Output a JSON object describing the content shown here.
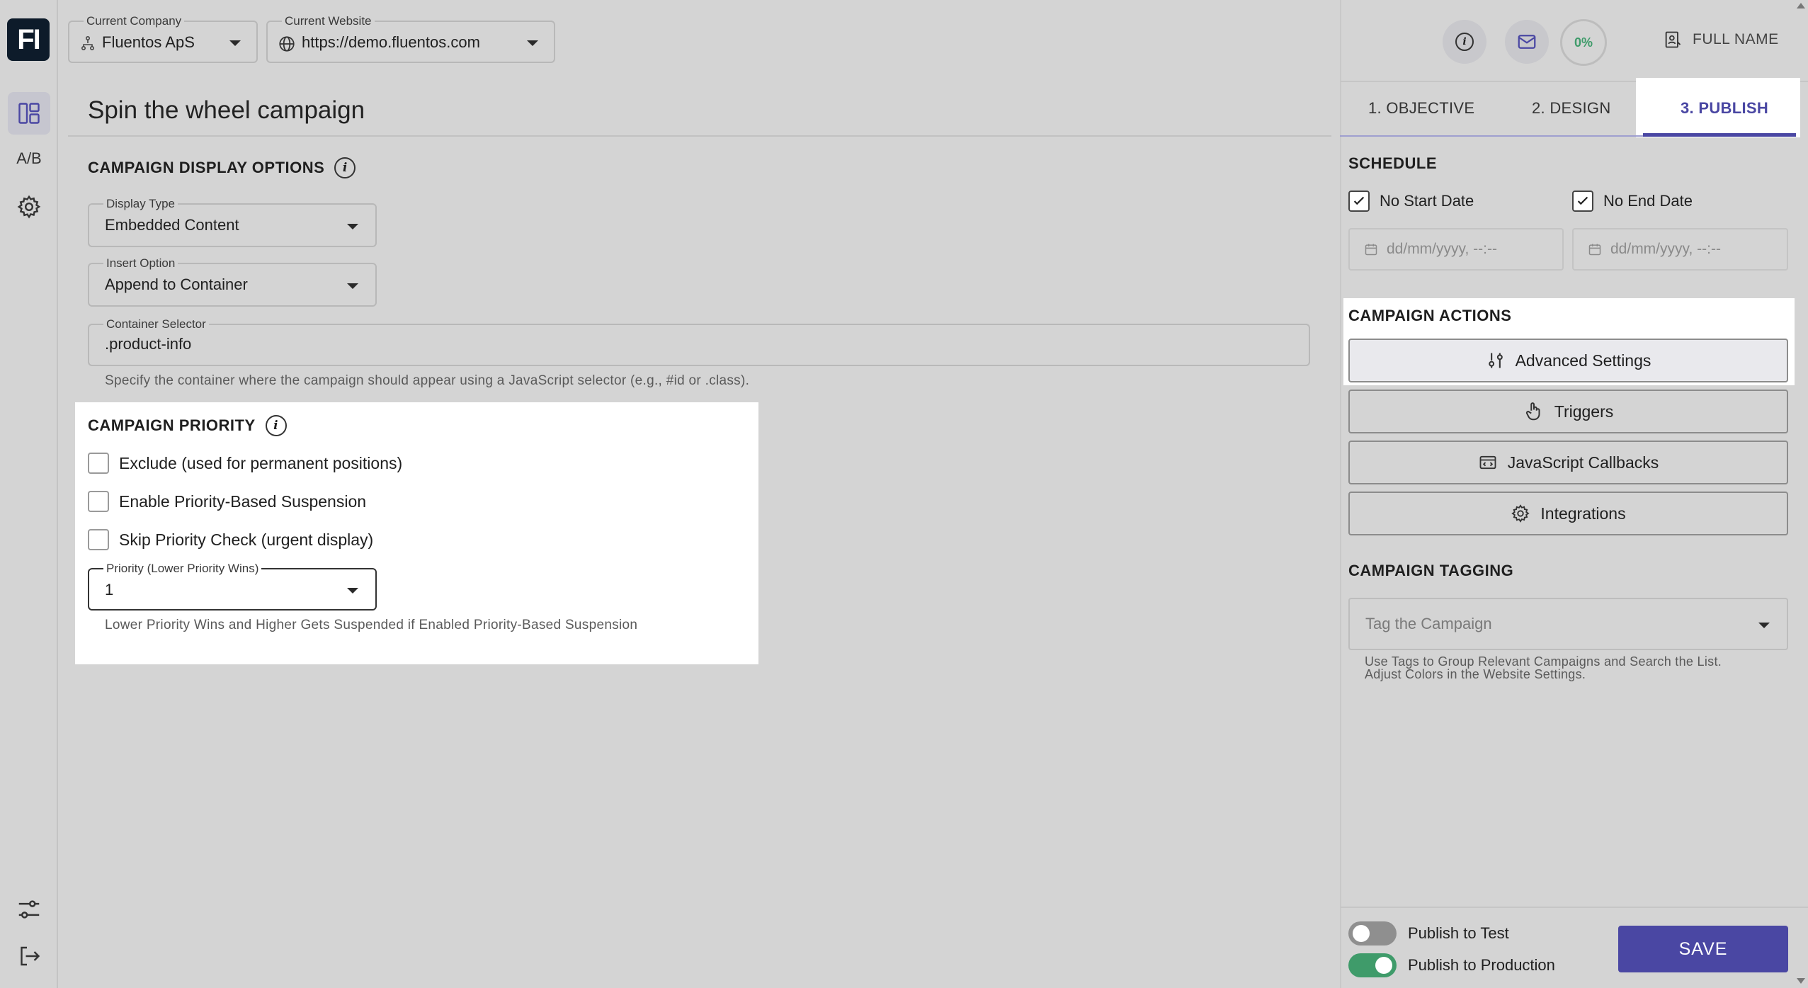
{
  "header": {
    "company_label": "Current Company",
    "company_value": "Fluentos ApS",
    "website_label": "Current Website",
    "website_value": "https://demo.fluentos.com",
    "progress": "0%",
    "user_name": "FULL NAME"
  },
  "sidebar": {
    "logo": "FI",
    "ab_label": "A/B"
  },
  "main": {
    "title": "Spin the wheel campaign",
    "display_options": {
      "heading": "CAMPAIGN DISPLAY OPTIONS",
      "display_type_label": "Display Type",
      "display_type_value": "Embedded Content",
      "insert_option_label": "Insert Option",
      "insert_option_value": "Append to Container",
      "container_selector_label": "Container Selector",
      "container_selector_value": ".product-info",
      "container_helper": "Specify the container where the campaign should appear using a JavaScript selector (e.g., #id or .class)."
    },
    "priority": {
      "heading": "CAMPAIGN PRIORITY",
      "checkbox_exclude": "Exclude (used for permanent positions)",
      "checkbox_suspension": "Enable Priority-Based Suspension",
      "checkbox_skip": "Skip Priority Check (urgent display)",
      "priority_label": "Priority (Lower Priority Wins)",
      "priority_value": "1",
      "priority_helper": "Lower Priority Wins and Higher Gets Suspended if Enabled Priority-Based Suspension"
    }
  },
  "right_panel": {
    "tabs": [
      {
        "label": "1. OBJECTIVE"
      },
      {
        "label": "2. DESIGN"
      },
      {
        "label": "3. PUBLISH"
      }
    ],
    "schedule": {
      "heading": "SCHEDULE",
      "no_start_date": "No Start Date",
      "no_end_date": "No End Date",
      "start_placeholder": "dd/mm/yyyy, --:--",
      "end_placeholder": "dd/mm/yyyy, --:--"
    },
    "actions": {
      "heading": "CAMPAIGN ACTIONS",
      "advanced_settings": "Advanced Settings",
      "triggers": "Triggers",
      "js_callbacks": "JavaScript Callbacks",
      "integrations": "Integrations"
    },
    "tagging": {
      "heading": "CAMPAIGN TAGGING",
      "placeholder": "Tag the Campaign",
      "helper_line1": "Use Tags to Group Relevant Campaigns and Search the List.",
      "helper_line2": "Adjust Colors in the Website Settings."
    },
    "footer": {
      "publish_test": "Publish to Test",
      "publish_production": "Publish to Production",
      "save": "SAVE"
    }
  },
  "colors": {
    "accent": "#4a47a3",
    "toggle_on": "#3f9b6a",
    "toggle_off": "#8f8f8f",
    "logo_bg": "#0d1b2a"
  }
}
